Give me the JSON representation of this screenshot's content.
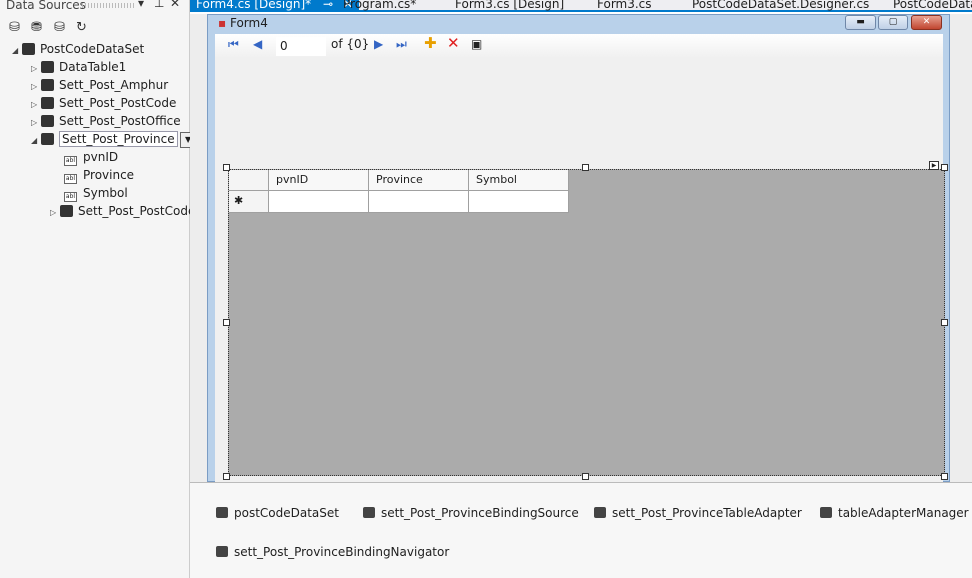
{
  "panel": {
    "title": "Data Sources",
    "toolbar": [
      "add-datasource-icon",
      "edit-dataset-icon",
      "configure-icon",
      "refresh-icon"
    ]
  },
  "tree": {
    "root": "PostCodeDataSet",
    "tables": [
      "DataTable1",
      "Sett_Post_Amphur",
      "Sett_Post_PostCode",
      "Sett_Post_PostOffice"
    ],
    "selected": "Sett_Post_Province",
    "fields": [
      "pvnID",
      "Province",
      "Symbol"
    ],
    "child": "Sett_Post_PostCode"
  },
  "tabs": [
    "Form4.cs [Design]*",
    "Program.cs*",
    "Form3.cs [Design]",
    "Form3.cs",
    "PostCodeDataSet.Designer.cs",
    "PostCodeDataSet"
  ],
  "form": {
    "title": "Form4"
  },
  "navigator": {
    "position": "0",
    "count": "of {0}"
  },
  "grid": {
    "columns": [
      "pvnID",
      "Province",
      "Symbol"
    ],
    "new_row_marker": "✱"
  },
  "tray": [
    "postCodeDataSet",
    "sett_Post_ProvinceBindingSource",
    "sett_Post_ProvinceTableAdapter",
    "tableAdapterManager",
    "sett_Post_ProvinceBindingNavigator"
  ]
}
